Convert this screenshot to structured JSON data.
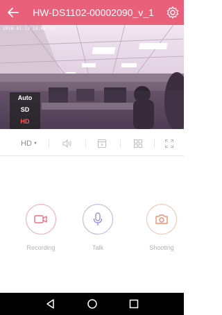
{
  "header": {
    "title": "HW-DS1102-00002090_v_1",
    "back_icon": "back-arrow-icon",
    "settings_icon": "settings-icon",
    "color": "#e8607a"
  },
  "video": {
    "osd_text": "2018-01-13 18:06:22",
    "quality_menu": {
      "options": [
        "Auto",
        "SD",
        "HD"
      ],
      "selected": "HD",
      "active_color": "#ff5a5a"
    }
  },
  "toolbar": {
    "quality_label": "HD",
    "items": [
      "quality-select",
      "volume-icon",
      "playback-icon",
      "multi-screen-icon",
      "fullscreen-icon"
    ]
  },
  "actions": [
    {
      "label": "Recording",
      "icon": "video-camera-icon",
      "color": "#f1a4b0"
    },
    {
      "label": "Talk",
      "icon": "microphone-icon",
      "color": "#b6b1e6"
    },
    {
      "label": "Shooting",
      "icon": "camera-icon",
      "color": "#f5c0ad"
    }
  ],
  "navbar": {
    "buttons": [
      "back-triangle-icon",
      "home-circle-icon",
      "recents-square-icon"
    ]
  }
}
